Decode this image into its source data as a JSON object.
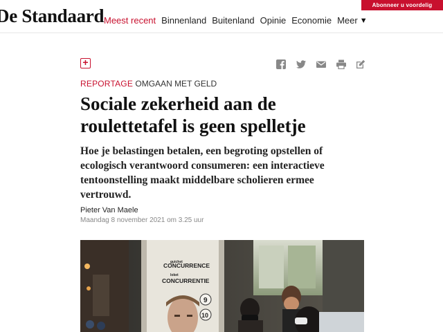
{
  "header": {
    "brand": "De Standaard",
    "subscribe_label": "Abonneer u voordelig",
    "nav": [
      {
        "label": "Meest recent",
        "active": true
      },
      {
        "label": "Binnenland",
        "active": false
      },
      {
        "label": "Buitenland",
        "active": false
      },
      {
        "label": "Opinie",
        "active": false
      },
      {
        "label": "Economie",
        "active": false
      },
      {
        "label": "Meer",
        "active": false
      }
    ],
    "more_caret": "▼"
  },
  "toolbar": {
    "bookmark_icon": "plus-square-icon",
    "share_icons": [
      "facebook-icon",
      "twitter-icon",
      "mail-icon",
      "print-icon",
      "edit-icon"
    ]
  },
  "article": {
    "section": "REPORTAGE",
    "tag": "OMGAAN MET GELD",
    "title": "Sociale zekerheid aan de roulettetafel is geen spelletje",
    "lead": "Hoe je belastingen betalen, een begroting opstellen of ecologisch verantwoord consumeren: een interactieve tentoonstelling maakt middelbare scholieren ermee vertrouwd.",
    "author": "Pieter Van Maele",
    "date": "Maandag 8 november 2021 om 3.25 uur"
  },
  "photo": {
    "sign_small_1": "guichet",
    "sign_big_1": "CONCURRENCE",
    "sign_small_2": "loket",
    "sign_big_2": "CONCURRENTIE",
    "counter_1": "9",
    "counter_2": "10"
  },
  "colors": {
    "accent": "#c8102e",
    "text": "#222222",
    "muted": "#888888"
  }
}
